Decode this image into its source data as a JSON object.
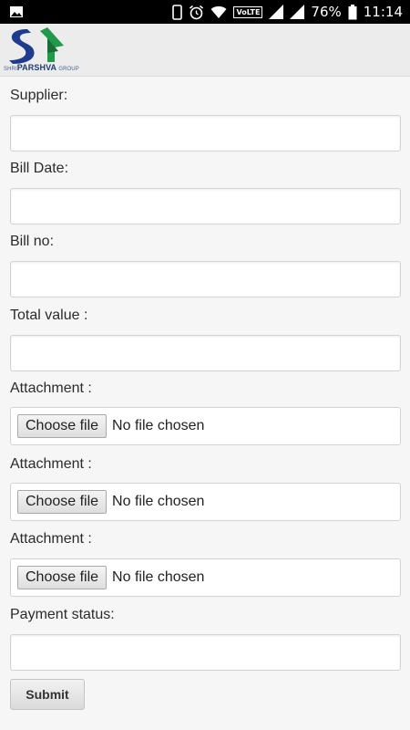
{
  "status_bar": {
    "battery": "76%",
    "time": "11:14",
    "network_badge": "VoLTE",
    "icons": [
      "image-icon",
      "phone-icon",
      "alarm-icon",
      "wifi-icon",
      "signal-icon",
      "battery-icon"
    ]
  },
  "header": {
    "logo_initials": "SP",
    "logo_prefix": "SHRI",
    "logo_name": "PARSHVA",
    "logo_suffix": "GROUP",
    "brand_colors": {
      "blue": "#1f3b8f",
      "green": "#1f9a49"
    }
  },
  "form": {
    "supplier_label": "Supplier:",
    "supplier_value": "",
    "bill_date_label": "Bill Date:",
    "bill_date_value": "",
    "bill_no_label": "Bill no:",
    "bill_no_value": "",
    "total_value_label": "Total value :",
    "total_value_value": "",
    "attachments": [
      {
        "label": "Attachment :",
        "button": "Choose file",
        "status": "No file chosen"
      },
      {
        "label": "Attachment :",
        "button": "Choose file",
        "status": "No file chosen"
      },
      {
        "label": "Attachment :",
        "button": "Choose file",
        "status": "No file chosen"
      }
    ],
    "payment_status_label": "Payment status:",
    "payment_status_value": "",
    "submit_label": "Submit"
  }
}
